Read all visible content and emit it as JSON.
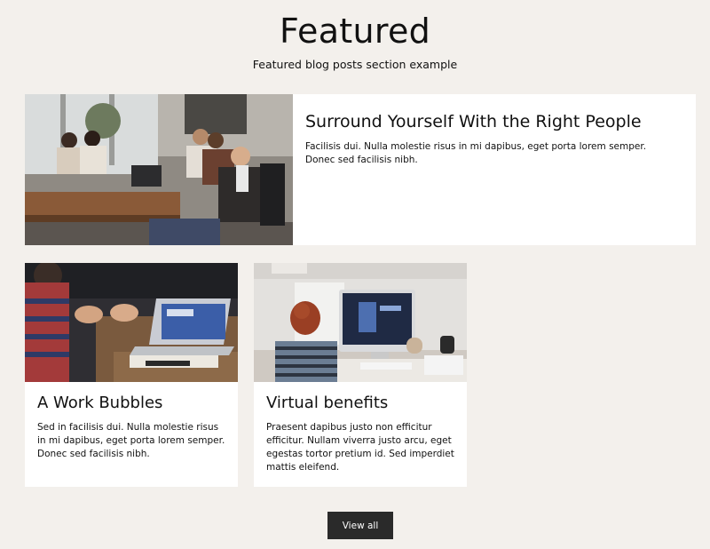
{
  "section": {
    "title": "Featured",
    "subtitle": "Featured blog posts section example"
  },
  "posts": [
    {
      "title": "Surround Yourself With the Right People",
      "excerpt": "Facilisis dui. Nulla molestie risus in mi dapibus, eget porta lorem semper. Donec sed facilisis nibh.",
      "image": "team-meeting-photo"
    },
    {
      "title": "A Work Bubbles",
      "excerpt": "Sed in facilisis dui. Nulla molestie risus in mi dapibus, eget porta lorem semper. Donec sed facilisis nibh.",
      "image": "laptop-discussion-photo"
    },
    {
      "title": "Virtual benefits",
      "excerpt": "Praesent dapibus justo non efficitur efficitur. Nullam viverra justo arcu, eget egestas tortor pretium id. Sed imperdiet mattis eleifend.",
      "image": "woman-at-computer-photo"
    }
  ],
  "view_all_label": "View all",
  "colors": {
    "background": "#f3f0ec",
    "card": "#ffffff",
    "button": "#2a2a2a",
    "text": "#111111"
  }
}
